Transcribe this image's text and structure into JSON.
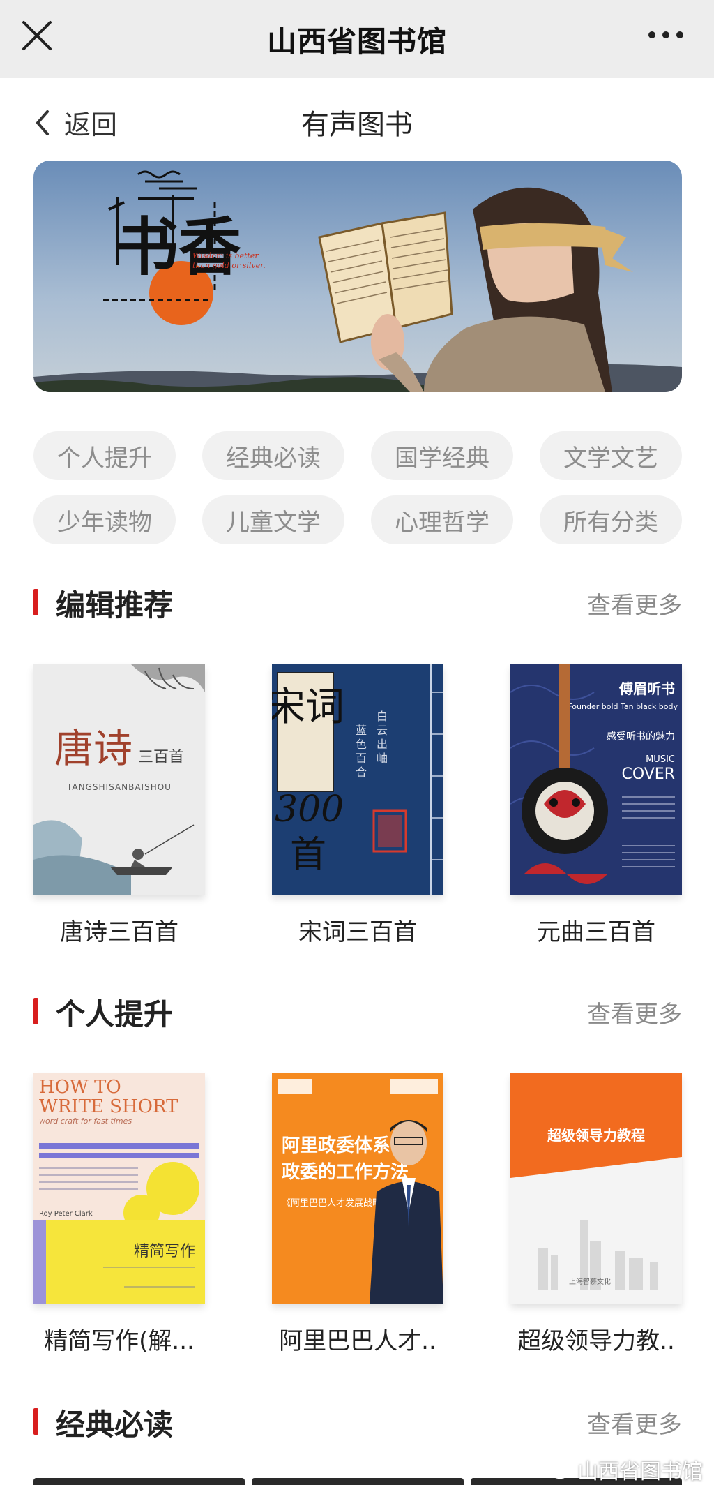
{
  "titlebar": {
    "title": "山西省图书馆",
    "close_icon": "close-icon",
    "more_icon": "more-dots-icon"
  },
  "navbar": {
    "back_label": "返回",
    "title": "有声图书"
  },
  "banner": {
    "logo_text": "书香",
    "quote_line1": "Wisdom is better",
    "quote_line2": "than gold or silver."
  },
  "categories": [
    "个人提升",
    "经典必读",
    "国学经典",
    "文学文艺",
    "少年读物",
    "儿童文学",
    "心理哲学",
    "所有分类"
  ],
  "sections": [
    {
      "title": "编辑推荐",
      "more": "查看更多",
      "books": [
        {
          "name": "唐诗三百首",
          "cover_title": "唐诗",
          "cover_sub": "三百首",
          "cover_en": "TANGSHISANBAISHOU"
        },
        {
          "name": "宋词三百首",
          "cover_title": "宋词",
          "cover_num": "300",
          "cover_last": "首"
        },
        {
          "name": "元曲三百首",
          "cover_title": "傅眉听书",
          "cover_en": "Founder bold Tan black body",
          "cover_sub": "感受听书的魅力",
          "cover_music": "MUSIC",
          "cover_cover": "COVER"
        }
      ]
    },
    {
      "title": "个人提升",
      "more": "查看更多",
      "books": [
        {
          "name": "精简写作(解...",
          "cover_en1": "HOW TO",
          "cover_en2": "WRITE SHORT",
          "cover_sub": "word craft for fast times",
          "cover_cn": "精简写作",
          "cover_author": "Roy Peter Clark"
        },
        {
          "name": "阿里巴巴人才..",
          "cover_line1": "阿里政委体系:",
          "cover_line2": "政委的工作方法",
          "cover_sub": "《阿里巴巴人才发展战略》"
        },
        {
          "name": "超级领导力教..",
          "cover_title": "超级领导力教程",
          "cover_foot": "上海智慕文化"
        }
      ]
    },
    {
      "title": "经典必读",
      "more": "查看更多"
    }
  ],
  "watermark": "山西省图书馆",
  "colors": {
    "accent": "#d81e1e",
    "chip_bg": "#f1f1f1",
    "titlebar_bg": "#ededed"
  }
}
